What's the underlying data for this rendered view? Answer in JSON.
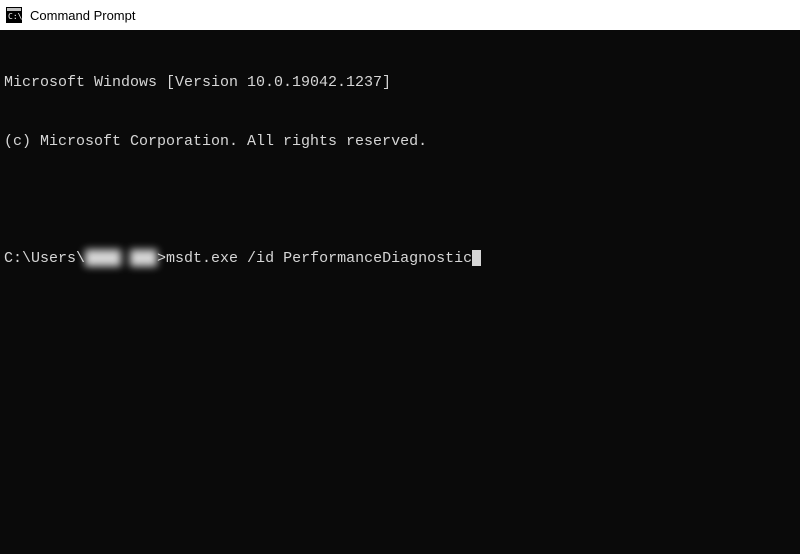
{
  "titlebar": {
    "title": "Command Prompt",
    "icon_name": "cmd-icon"
  },
  "terminal": {
    "line1": "Microsoft Windows [Version 10.0.19042.1237]",
    "line2": "(c) Microsoft Corporation. All rights reserved.",
    "prompt_prefix": "C:\\Users\\",
    "prompt_user_hidden": "████ ███",
    "prompt_suffix": ">",
    "command": "msdt.exe /id PerformanceDiagnostic"
  }
}
